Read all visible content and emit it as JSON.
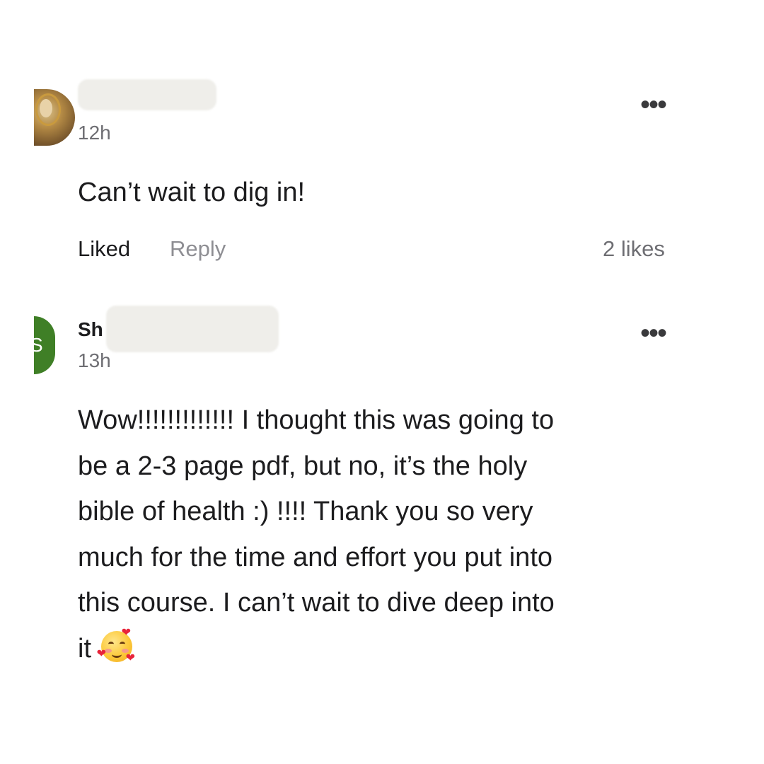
{
  "comments": [
    {
      "author_visible": "",
      "time": "12h",
      "text": "Can’t wait to dig in!",
      "liked_label": "Liked",
      "reply_label": "Reply",
      "likes": "2 likes",
      "more_icon": "more-horizontal-icon",
      "avatar": "photo"
    },
    {
      "author_visible": "Sh",
      "time": "13h",
      "text_lines": [
        "Wow!!!!!!!!!!!!!  I thought this was going to",
        "be a 2-3 page pdf, but no, it’s the holy",
        "bible of health :) !!!!  Thank you so very",
        "much for the time and effort you put into",
        "this course.  I can’t wait to dive deep into",
        "it"
      ],
      "emoji": "smiling-face-with-hearts",
      "more_icon": "more-horizontal-icon",
      "avatar_letter": "S",
      "avatar_color": "#3f7f26"
    }
  ],
  "colors": {
    "text_primary": "#1c1c1e",
    "text_secondary": "#6e6e73",
    "text_reply": "#8e8e93",
    "background": "#ffffff"
  }
}
